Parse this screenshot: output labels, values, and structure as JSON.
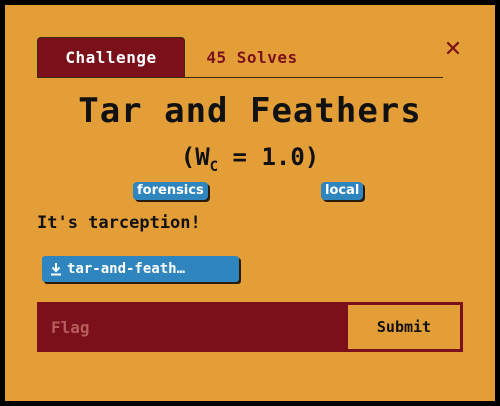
{
  "tabs": [
    {
      "label": "Challenge",
      "active": true
    },
    {
      "label": "45 Solves",
      "active": false
    }
  ],
  "close_icon": "close-icon",
  "challenge": {
    "title": "Tar and Feathers",
    "weight_prefix": "(W",
    "weight_sub": "C",
    "weight_suffix": " = 1.0)",
    "tags": [
      "forensics",
      "local"
    ],
    "description": "It's tarception!",
    "file_label": "tar-and-feath…",
    "file_icon": "download-icon"
  },
  "flag": {
    "placeholder": "Flag",
    "value": "",
    "submit_label": "Submit"
  },
  "colors": {
    "background": "#e39e37",
    "primary": "#7a101a",
    "tag": "#2f86bf"
  }
}
